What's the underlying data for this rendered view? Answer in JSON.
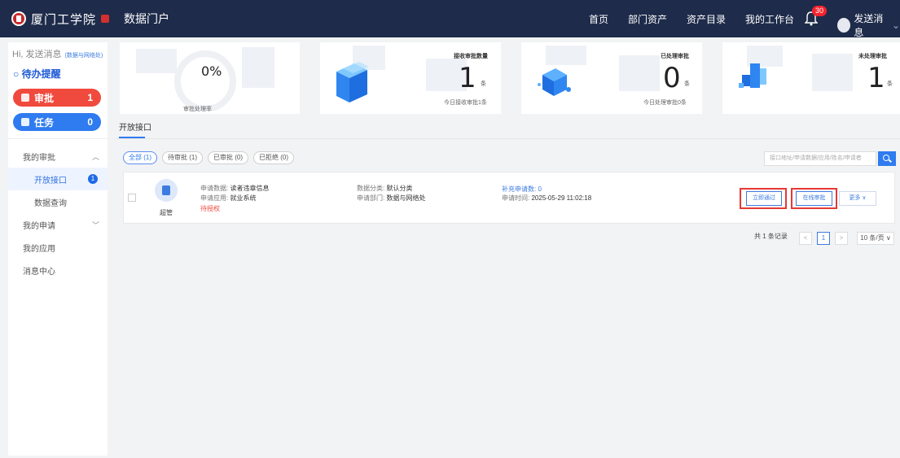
{
  "topbar": {
    "logo_text": "厦门工学院",
    "app_title": "数据门户",
    "nav": [
      "首页",
      "部门资产",
      "资产目录",
      "我的工作台"
    ],
    "bell_badge": "30",
    "user_name": "发送消息",
    "user_chevron": "⌄"
  },
  "sidebar": {
    "greeting": "Hi, 发送消息",
    "greeting_sub": "(数据与网络处)",
    "todo_title": "○ 待办提醒",
    "approve": {
      "label": "审批",
      "count": "1"
    },
    "task": {
      "label": "任务",
      "count": "0"
    },
    "menu": {
      "my_approval": "我的审批",
      "open_api": "开放接口",
      "open_api_count": "1",
      "data_query": "数据查询",
      "my_apply": "我的申请",
      "my_app": "我的应用",
      "msg_center": "消息中心"
    }
  },
  "stats": {
    "rate": {
      "value": "0%",
      "label": "审批处理率"
    },
    "received": {
      "title": "接收审批数量",
      "value": "1",
      "unit": "条",
      "sub": "今日接收审批1条"
    },
    "processed": {
      "title": "已处理审批",
      "value": "0",
      "unit": "条",
      "sub": "今日处理审批0条"
    },
    "pending": {
      "title": "未处理审批",
      "value": "1",
      "unit": "条"
    }
  },
  "tabs": {
    "active": "开放接口"
  },
  "filters": [
    "全部 (1)",
    "待审批 (1)",
    "已审批 (0)",
    "已拒绝 (0)"
  ],
  "search": {
    "placeholder": "接口地址/申请数据/应用/姓名/申请者"
  },
  "record": {
    "user": "超管",
    "apply_data_label": "申请数据:",
    "apply_data": "读者违章信息",
    "apply_app_label": "申请应用:",
    "apply_app": "就业系统",
    "status": "待授权",
    "category_label": "数据分类:",
    "category": "默认分类",
    "dept_label": "申请部门:",
    "dept": "数据与网络处",
    "extra": "补充申请数: 0",
    "time_label": "申请时间:",
    "time": "2025-05-29 11:02:18",
    "btn_pass": "立即通过",
    "btn_online": "在线审批",
    "btn_more": "更多 ∨"
  },
  "pager": {
    "total": "共 1 条记录",
    "page": "1",
    "prev": "<",
    "next": ">",
    "size": "10 条/页 ∨"
  },
  "colors": {
    "topbar": "#1e2b4a",
    "accent": "#2f7bf0",
    "danger": "#f04a3e",
    "highlight_box": "#e53935"
  }
}
